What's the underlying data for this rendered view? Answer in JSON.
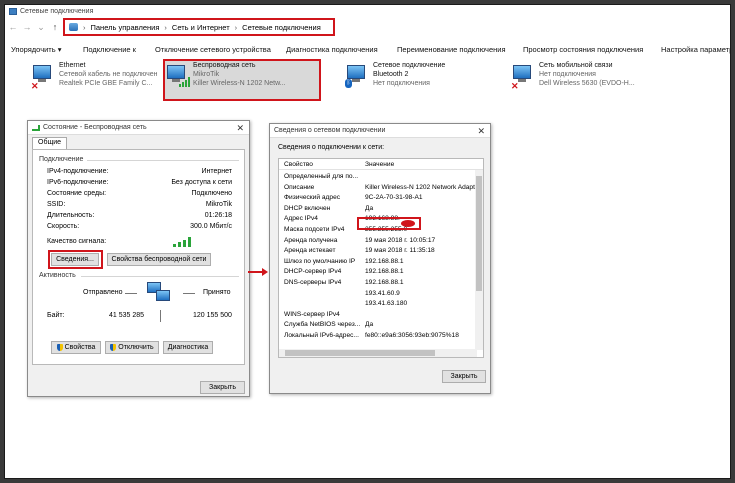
{
  "window": {
    "title": "Сетевые подключения"
  },
  "breadcrumb": [
    "Панель управления",
    "Сеть и Интернет",
    "Сетевые подключения"
  ],
  "nav": {
    "back": "←",
    "forward": "→",
    "history": "⌄",
    "up": "↑"
  },
  "toolbar": [
    "Упорядочить ▾",
    "Подключение к",
    "Отключение сетевого устройства",
    "Диагностика подключения",
    "Переименование подключения",
    "Просмотр состояния подключения",
    "Настройка параметр"
  ],
  "connections": [
    {
      "name": "Ethernet",
      "status": "Сетевой кабель не подключен",
      "device": "Realtek PCIe GBE Family C..."
    },
    {
      "name": "Беспроводная сеть",
      "status": "MikroTik",
      "device": "Killer Wireless-N 1202 Netw..."
    },
    {
      "name": "Сетевое подключение Bluetooth 2",
      "status": "Нет подключения",
      "device": ""
    },
    {
      "name": "Сеть мобильной связи",
      "status": "Нет подключения",
      "device": "Dell Wireless 5630 (EVDO-H..."
    }
  ],
  "status_dialog": {
    "title": "Состояние - Беспроводная сеть",
    "tab": "Общие",
    "section_connection": "Подключение",
    "rows": [
      {
        "label": "IPv4-подключение:",
        "value": "Интернет"
      },
      {
        "label": "IPv6-подключение:",
        "value": "Без доступа к сети"
      },
      {
        "label": "Состояние среды:",
        "value": "Подключено"
      },
      {
        "label": "SSID:",
        "value": "MikroTik"
      },
      {
        "label": "Длительность:",
        "value": "01:26:18"
      },
      {
        "label": "Скорость:",
        "value": "300.0 Мбит/с"
      }
    ],
    "signal_label": "Качество сигнала:",
    "details_button": "Сведения...",
    "wireless_props_button": "Свойства беспроводной сети",
    "section_activity": "Активность",
    "sent_label": "Отправлено",
    "received_label": "Принято",
    "bytes_label": "Байт:",
    "bytes_sent": "41 535 285",
    "bytes_received": "120 155 500",
    "properties_button": "Свойства",
    "disable_button": "Отключить",
    "diagnose_button": "Диагностика",
    "close_button": "Закрыть"
  },
  "details_dialog": {
    "title": "Сведения о сетевом подключении",
    "subtitle": "Сведения о подключении к сети:",
    "col_property": "Свойство",
    "col_value": "Значение",
    "rows": [
      {
        "p": "Определенный для по...",
        "v": ""
      },
      {
        "p": "Описание",
        "v": "Killer Wireless-N 1202 Network Adapte"
      },
      {
        "p": "Физический адрес",
        "v": "9C-2A-70-31-98-A1"
      },
      {
        "p": "DHCP включен",
        "v": "Да"
      },
      {
        "p": "Адрес IPv4",
        "v": "192.168.88."
      },
      {
        "p": "Маска подсети IPv4",
        "v": "255.255.255.0"
      },
      {
        "p": "Аренда получена",
        "v": "19 мая 2018 г. 10:05:17"
      },
      {
        "p": "Аренда истекает",
        "v": "19 мая 2018 г. 11:35:18"
      },
      {
        "p": "Шлюз по умолчанию IP",
        "v": "192.168.88.1"
      },
      {
        "p": "DHCP-сервер IPv4",
        "v": "192.168.88.1"
      },
      {
        "p": "DNS-серверы IPv4",
        "v": "192.168.88.1"
      },
      {
        "p": "",
        "v": "193.41.60.9"
      },
      {
        "p": "",
        "v": "193.41.63.180"
      },
      {
        "p": "WINS-сервер IPv4",
        "v": ""
      },
      {
        "p": "Служба NetBIOS через...",
        "v": "Да"
      },
      {
        "p": "Локальный IPv6-адрес...",
        "v": "fe80::e9a6:3056:93eb:9075%18"
      }
    ],
    "close_button": "Закрыть"
  },
  "colors": {
    "highlight": "#d0151b",
    "icon_blue": "#1f6fc0",
    "signal_green": "#2aa43a"
  }
}
